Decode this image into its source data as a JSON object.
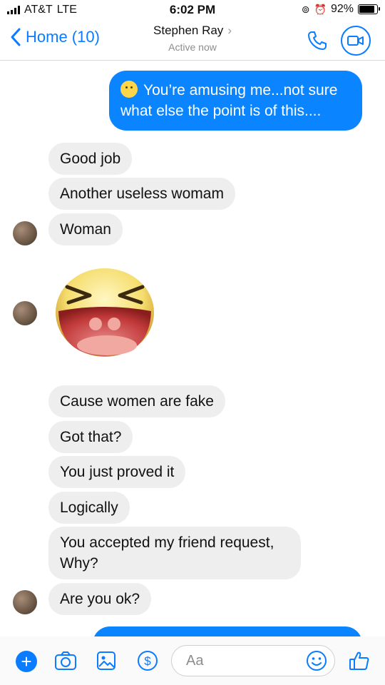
{
  "status": {
    "carrier": "AT&T",
    "network": "LTE",
    "time": "6:02 PM",
    "battery": "92%"
  },
  "header": {
    "back_label": "Home (10)",
    "contact_name": "Stephen Ray",
    "presence": "Active now"
  },
  "messages": [
    {
      "side": "out",
      "text": "You’re amusing me...not sure what else the point is of this...."
    },
    {
      "side": "in",
      "text": "Good job"
    },
    {
      "side": "in",
      "text": "Another useless womam"
    },
    {
      "side": "in",
      "text": "Woman"
    },
    {
      "side": "in",
      "sticker": "laughing-emoji"
    },
    {
      "side": "in",
      "text": "Cause women are fake"
    },
    {
      "side": "in",
      "text": "Got that?"
    },
    {
      "side": "in",
      "text": "You just proved it"
    },
    {
      "side": "in",
      "text": "Logically"
    },
    {
      "side": "in",
      "text": "You accepted my friend request, Why?"
    },
    {
      "side": "in",
      "text": "Are you ok?"
    }
  ],
  "composer": {
    "placeholder": "Aa"
  },
  "colors": {
    "accent": "#0a7cff",
    "outgoing_bubble": "#0a84ff",
    "incoming_bubble": "#eeeeef"
  }
}
